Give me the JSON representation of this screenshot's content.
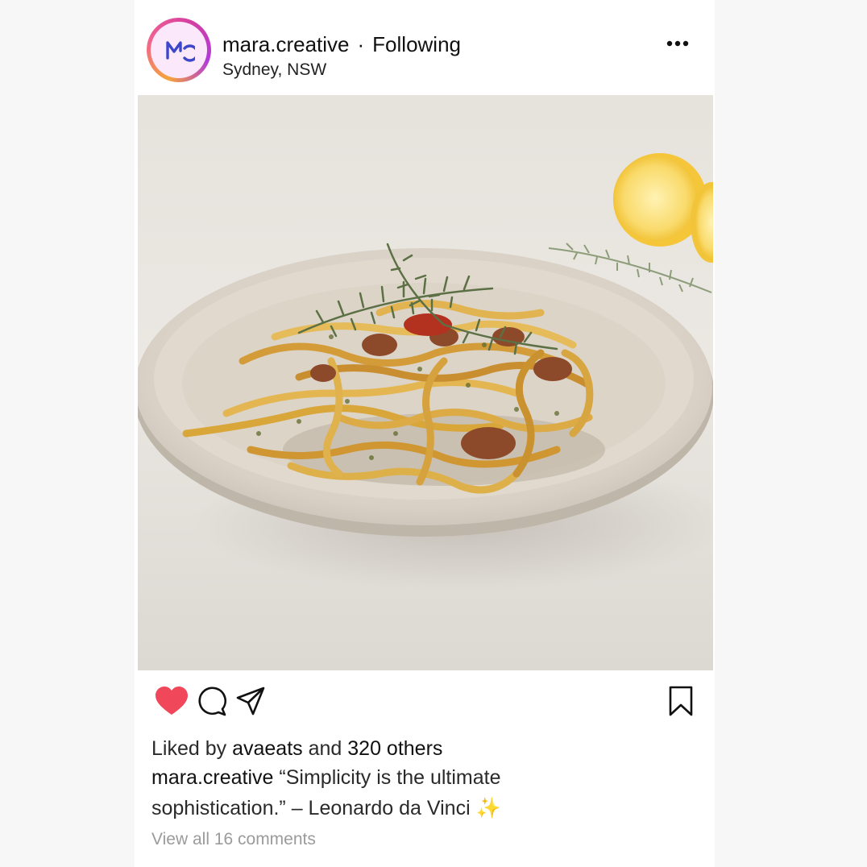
{
  "post": {
    "username": "mara.creative",
    "separator": "·",
    "follow_status": "Following",
    "location": "Sydney, NSW",
    "avatar_monogram": "MC",
    "more_icon": "more-horizontal-icon"
  },
  "actions": {
    "like_icon": "heart-filled-icon",
    "comment_icon": "comment-icon",
    "share_icon": "send-icon",
    "save_icon": "bookmark-icon",
    "like_color": "#f0475a"
  },
  "likes": {
    "prefix": "Liked by",
    "user": "avaeats",
    "middle": "and",
    "count_text": "320 others"
  },
  "caption": {
    "username": "mara.creative",
    "text": "“Simplicity is the ultimate sophistication.” – Leonardo da Vinci",
    "emoji": "✨"
  },
  "comments": {
    "label": "View all 16 comments"
  },
  "colors": {
    "story_ring_start": "#f5a33b",
    "story_ring_end": "#b23ad9",
    "avatar_mark": "#3d47c9",
    "muted_text": "#9b9b9b"
  }
}
